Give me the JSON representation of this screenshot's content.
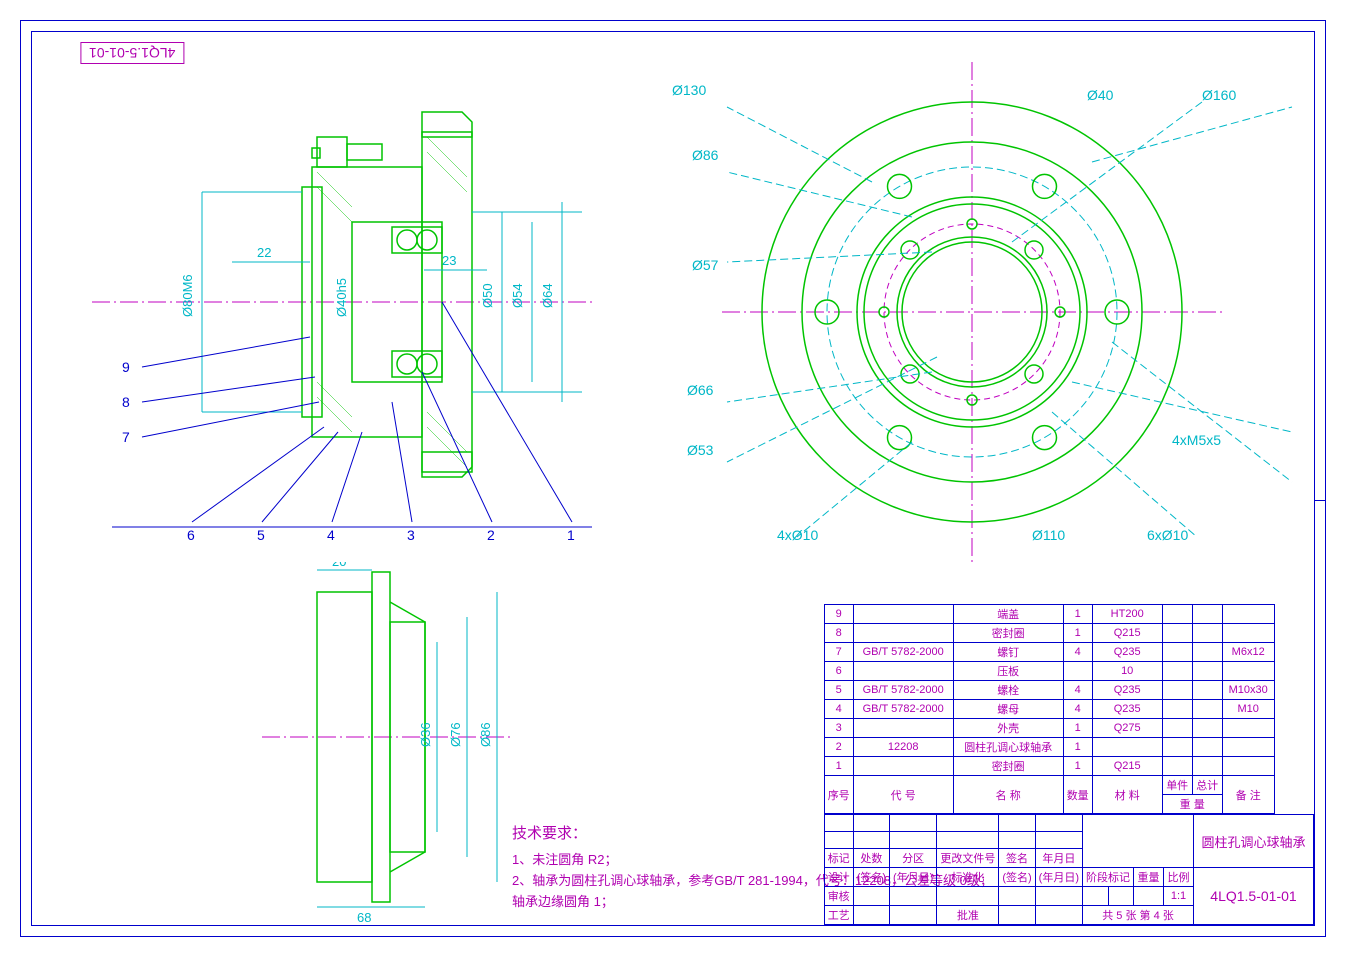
{
  "drawing_no": "4LQ1.5-01-01",
  "rot_label": "4LQ1.5-01-01",
  "title": "圆柱孔调心球轴承",
  "scale": "1:1",
  "sheet": "共 5 张 第 4 张",
  "tech_req_title": "技术要求：",
  "tech_req": [
    "1、未注圆角  R2；",
    "2、轴承为圆柱孔调心球轴承，参考GB/T  281-1994，代号：12208，公差等级  0级；",
    "    轴承边缘圆角  1；"
  ],
  "left_dims": {
    "w22": "22",
    "w23": "23",
    "d80": "Ø80M6",
    "d40h5": "Ø40h5",
    "d50": "Ø50",
    "d54": "Ø54",
    "d64": "Ø64"
  },
  "balloons": [
    "1",
    "2",
    "3",
    "4",
    "5",
    "6",
    "7",
    "8",
    "9"
  ],
  "bottom_dims": {
    "w20": "20",
    "w68": "68",
    "d36": "Ø36",
    "d76": "Ø76",
    "d86": "Ø86"
  },
  "right_dims": {
    "d130": "Ø130",
    "d40": "Ø40",
    "d160": "Ø160",
    "d86": "Ø86",
    "d57": "Ø57",
    "d66": "Ø66",
    "d53": "Ø53",
    "d110": "Ø110",
    "holes4": "4xØ10",
    "holes6": "6xØ10",
    "tap": "4xM5x5"
  },
  "bom_header": [
    "序号",
    "代    号",
    "名    称",
    "数量",
    "材    料",
    "单件",
    "总计",
    "备  注"
  ],
  "bom_sub": {
    "wt": "重  量"
  },
  "bom": [
    {
      "no": "9",
      "code": "",
      "name": "端盖",
      "qty": "1",
      "mat": "HT200",
      "w1": "",
      "w2": "",
      "rem": ""
    },
    {
      "no": "8",
      "code": "",
      "name": "密封圈",
      "qty": "1",
      "mat": "Q215",
      "w1": "",
      "w2": "",
      "rem": ""
    },
    {
      "no": "7",
      "code": "GB/T 5782-2000",
      "name": "螺钉",
      "qty": "4",
      "mat": "Q235",
      "w1": "",
      "w2": "",
      "rem": "M6x12"
    },
    {
      "no": "6",
      "code": "",
      "name": "压板",
      "qty": "",
      "mat": "10",
      "w1": "",
      "w2": "",
      "rem": ""
    },
    {
      "no": "5",
      "code": "GB/T 5782-2000",
      "name": "螺栓",
      "qty": "4",
      "mat": "Q235",
      "w1": "",
      "w2": "",
      "rem": "M10x30"
    },
    {
      "no": "4",
      "code": "GB/T 5782-2000",
      "name": "螺母",
      "qty": "4",
      "mat": "Q235",
      "w1": "",
      "w2": "",
      "rem": "M10"
    },
    {
      "no": "3",
      "code": "",
      "name": "外壳",
      "qty": "1",
      "mat": "Q275",
      "w1": "",
      "w2": "",
      "rem": ""
    },
    {
      "no": "2",
      "code": "12208",
      "name": "圆柱孔调心球轴承",
      "qty": "1",
      "mat": "",
      "w1": "",
      "w2": "",
      "rem": ""
    },
    {
      "no": "1",
      "code": "",
      "name": "密封圈",
      "qty": "1",
      "mat": "Q215",
      "w1": "",
      "w2": "",
      "rem": ""
    }
  ],
  "rev_hdr": [
    "标记",
    "处数",
    "分区",
    "更改文件号",
    "签名",
    "年月日"
  ],
  "sign_rows": {
    "r1": [
      "设计",
      "(签名)",
      "(年月日)",
      "标准化",
      "(签名)",
      "(年月日)"
    ],
    "r2a": "审核",
    "r2b": "工艺",
    "r2c": "批准",
    "stage": "阶段标记",
    "wt": "重量",
    "sc": "比例"
  }
}
